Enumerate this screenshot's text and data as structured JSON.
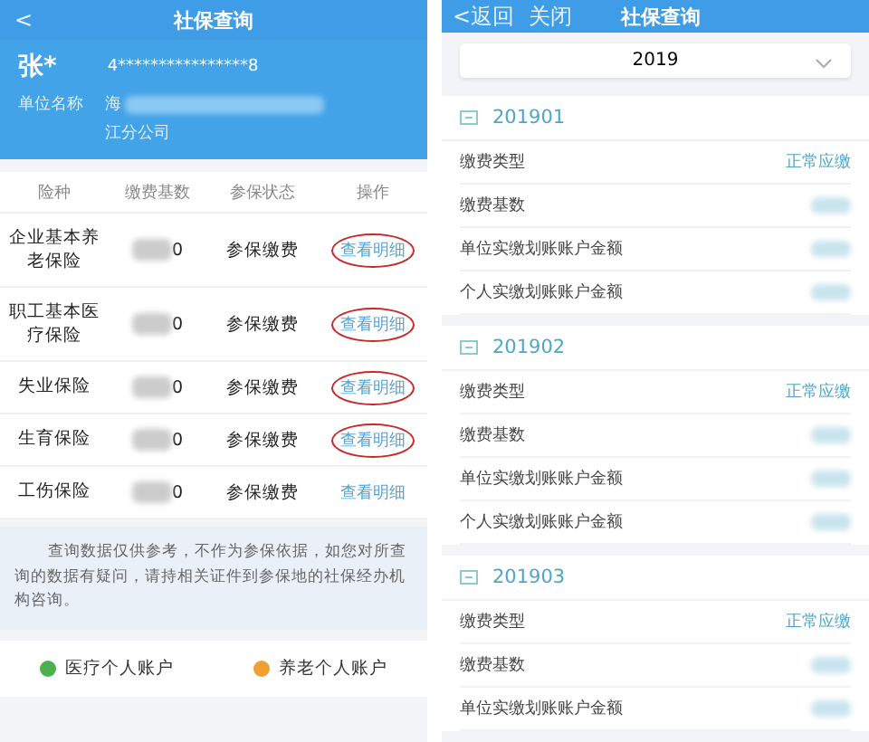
{
  "left": {
    "title_bar": {
      "back": "<",
      "title": "社保查询"
    },
    "person": {
      "name": "张*",
      "id": "4****************8",
      "company_label": "单位名称",
      "company_lines": [
        "海",
        "江分公司"
      ],
      "company_redacted": true
    },
    "table": {
      "columns": [
        "险种",
        "缴费基数",
        "参保状态",
        "操作"
      ],
      "rows": [
        {
          "type": "企业基本养老保险",
          "base": "0",
          "base_redacted": true,
          "status": "参保缴费",
          "action": "查看明细",
          "circled": true
        },
        {
          "type": "职工基本医疗保险",
          "base": "0",
          "base_redacted": true,
          "status": "参保缴费",
          "action": "查看明细",
          "circled": true
        },
        {
          "type": "失业保险",
          "base": "0",
          "base_redacted": true,
          "status": "参保缴费",
          "action": "查看明细",
          "circled": true
        },
        {
          "type": "生育保险",
          "base": "0",
          "base_redacted": true,
          "status": "参保缴费",
          "action": "查看明细",
          "circled": true
        },
        {
          "type": "工伤保险",
          "base": "0",
          "base_redacted": true,
          "status": "参保缴费",
          "action": "查看明细",
          "circled": false
        }
      ]
    },
    "notice": "查询数据仅供参考，不作为参保依据，如您对所查询的数据有疑问，请持相关证件到参保地的社保经办机构咨询。",
    "accounts": [
      {
        "label": "医疗个人账户",
        "color": "#4caf50"
      },
      {
        "label": "养老个人账户",
        "color": "#f0a030"
      }
    ]
  },
  "right": {
    "title_bar": {
      "back": "<返回",
      "close": "关闭",
      "title": "社保查询"
    },
    "year_select": {
      "value": "2019"
    },
    "months": [
      {
        "month": "201901",
        "rows": [
          {
            "label": "缴费类型",
            "value": "正常应缴"
          },
          {
            "label": "缴费基数",
            "redacted": true
          },
          {
            "label": "单位实缴划账账户金额",
            "redacted": true
          },
          {
            "label": "个人实缴划账账户金额",
            "redacted": true
          }
        ]
      },
      {
        "month": "201902",
        "rows": [
          {
            "label": "缴费类型",
            "value": "正常应缴"
          },
          {
            "label": "缴费基数",
            "redacted": true
          },
          {
            "label": "单位实缴划账账户金额",
            "redacted": true
          },
          {
            "label": "个人实缴划账账户金额",
            "redacted": true
          }
        ]
      },
      {
        "month": "201903",
        "rows": [
          {
            "label": "缴费类型",
            "value": "正常应缴"
          },
          {
            "label": "缴费基数",
            "redacted": true
          },
          {
            "label": "单位实缴划账账户金额",
            "redacted": true
          }
        ]
      }
    ]
  }
}
